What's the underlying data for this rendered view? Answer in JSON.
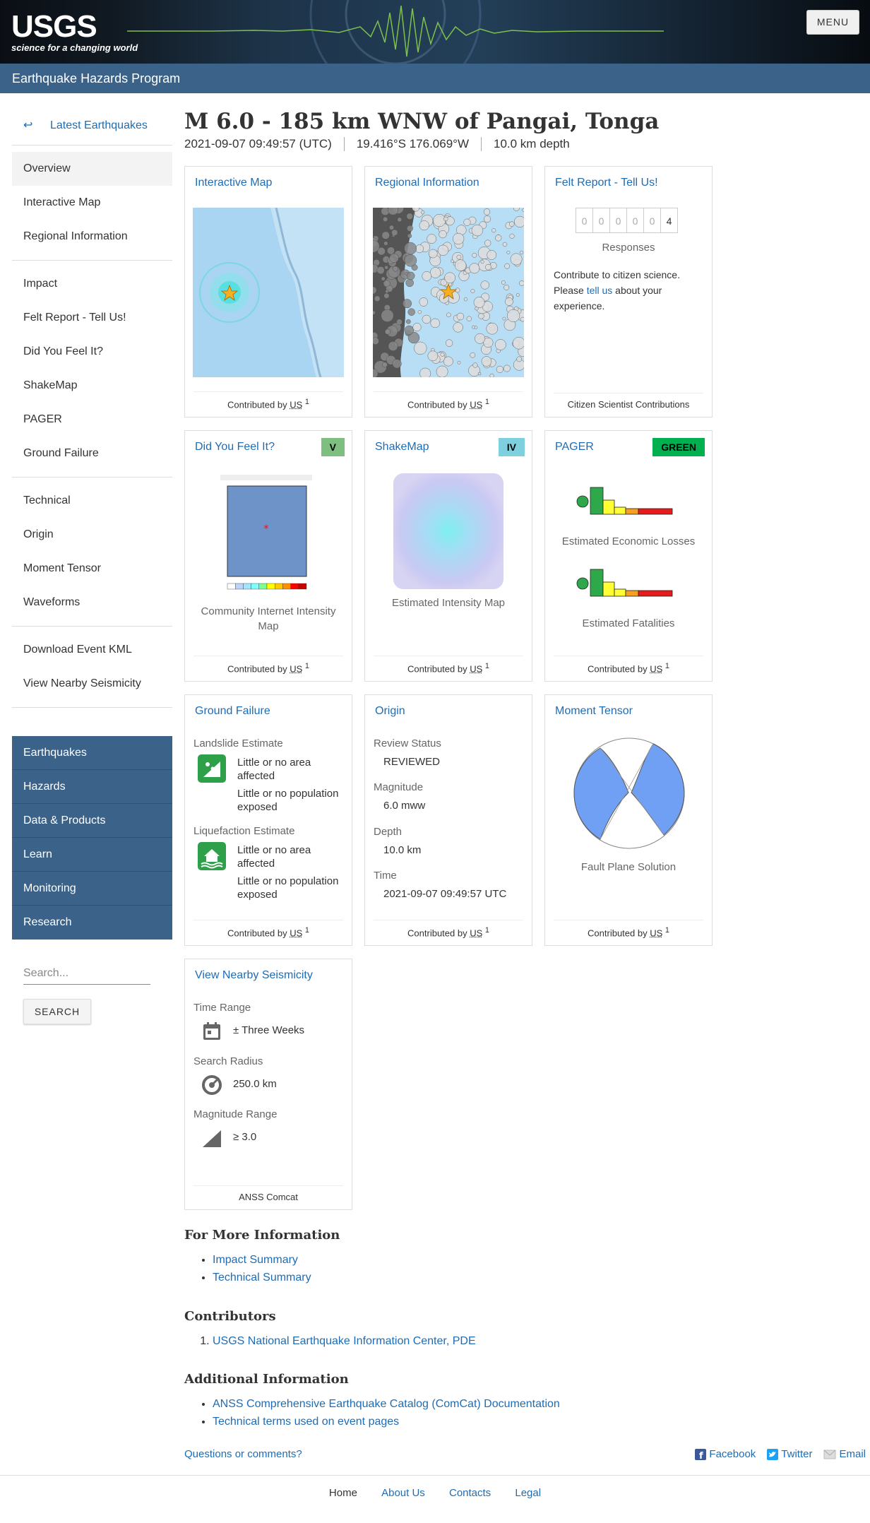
{
  "header": {
    "logo_text": "USGS",
    "tagline": "science for a changing world",
    "menu_label": "MENU"
  },
  "section_title": "Earthquake Hazards Program",
  "sidebar": {
    "back_label": "Latest Earthquakes",
    "back_icon": "left-arrow-icon",
    "groups": [
      [
        "Overview",
        "Interactive Map",
        "Regional Information"
      ],
      [
        "Impact",
        "Felt Report - Tell Us!",
        "Did You Feel It?",
        "ShakeMap",
        "PAGER",
        "Ground Failure"
      ],
      [
        "Technical",
        "Origin",
        "Moment Tensor",
        "Waveforms"
      ],
      [
        "Download Event KML",
        "View Nearby Seismicity"
      ]
    ],
    "nav": [
      "Earthquakes",
      "Hazards",
      "Data & Products",
      "Learn",
      "Monitoring",
      "Research"
    ],
    "search_placeholder": "Search...",
    "search_button": "SEARCH"
  },
  "event": {
    "title": "M 6.0 - 185 km WNW of Pangai, Tonga",
    "time": "2021-09-07 09:49:57 (UTC)",
    "location": "19.416°S 176.069°W",
    "depth": "10.0 km depth"
  },
  "cards": {
    "interactive_map": {
      "title": "Interactive Map",
      "foot_prefix": "Contributed by ",
      "foot_abbr": "US",
      "foot_sup": "1"
    },
    "regional": {
      "title": "Regional Information",
      "foot_prefix": "Contributed by ",
      "foot_abbr": "US",
      "foot_sup": "1"
    },
    "felt": {
      "title": "Felt Report - Tell Us!",
      "digits": [
        "0",
        "0",
        "0",
        "0",
        "0",
        "4"
      ],
      "responses_label": "Responses",
      "text1": "Contribute to citizen science. Please ",
      "link": "tell us",
      "text2": " about your experience.",
      "foot": "Citizen Scientist Contributions"
    },
    "dyfi": {
      "title": "Did You Feel It?",
      "badge": "V",
      "badge_color": "#7dbf7e",
      "caption": "Community Internet Intensity Map",
      "foot_prefix": "Contributed by ",
      "foot_abbr": "US",
      "foot_sup": "1"
    },
    "shakemap": {
      "title": "ShakeMap",
      "badge": "IV",
      "badge_color": "#7fd0df",
      "caption": "Estimated Intensity Map",
      "foot_prefix": "Contributed by ",
      "foot_abbr": "US",
      "foot_sup": "1"
    },
    "pager": {
      "title": "PAGER",
      "badge": "GREEN",
      "badge_color": "#00b050",
      "caption1": "Estimated Economic Losses",
      "caption2": "Estimated Fatalities",
      "foot_prefix": "Contributed by ",
      "foot_abbr": "US",
      "foot_sup": "1"
    },
    "ground_failure": {
      "title": "Ground Failure",
      "landslide_label": "Landslide Estimate",
      "landslide_area": "Little or no area affected",
      "landslide_pop": "Little or no population exposed",
      "liquefaction_label": "Liquefaction Estimate",
      "liq_area": "Little or no area affected",
      "liq_pop": "Little or no population exposed",
      "foot_prefix": "Contributed by ",
      "foot_abbr": "US",
      "foot_sup": "1"
    },
    "origin": {
      "title": "Origin",
      "review_label": "Review Status",
      "review_value": "REVIEWED",
      "mag_label": "Magnitude",
      "mag_value": "6.0 mww",
      "depth_label": "Depth",
      "depth_value": "10.0 km",
      "time_label": "Time",
      "time_value": "2021-09-07 09:49:57 UTC",
      "foot_prefix": "Contributed by ",
      "foot_abbr": "US",
      "foot_sup": "1"
    },
    "moment_tensor": {
      "title": "Moment Tensor",
      "caption": "Fault Plane Solution",
      "foot_prefix": "Contributed by ",
      "foot_abbr": "US",
      "foot_sup": "1"
    },
    "nearby": {
      "title": "View Nearby Seismicity",
      "time_label": "Time Range",
      "time_value": "± Three Weeks",
      "radius_label": "Search Radius",
      "radius_value": "250.0 km",
      "mag_label": "Magnitude Range",
      "mag_value": "≥ 3.0",
      "foot": "ANSS Comcat"
    }
  },
  "more_info": {
    "heading": "For More Information",
    "links": [
      "Impact Summary",
      "Technical Summary"
    ]
  },
  "contributors": {
    "heading": "Contributors",
    "items": [
      "USGS National Earthquake Information Center, PDE"
    ]
  },
  "additional": {
    "heading": "Additional Information",
    "links": [
      "ANSS Comprehensive Earthquake Catalog (ComCat) Documentation",
      "Technical terms used on event pages"
    ]
  },
  "footer": {
    "questions": "Questions or comments?",
    "facebook": "Facebook",
    "twitter": "Twitter",
    "email": "Email",
    "bottom_links": [
      "Home",
      "About Us",
      "Contacts",
      "Legal"
    ]
  }
}
